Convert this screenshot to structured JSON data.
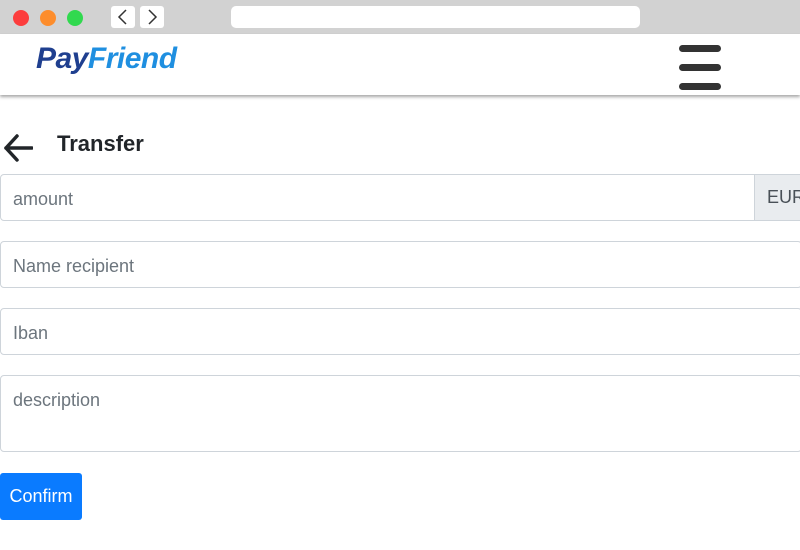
{
  "browser": {
    "back_icon": "chevron-left-icon",
    "forward_icon": "chevron-right-icon",
    "url": ""
  },
  "header": {
    "logo_part1": "Pay",
    "logo_part2": "Friend",
    "menu_icon": "hamburger-menu-icon"
  },
  "page": {
    "back_icon": "arrow-left-icon",
    "title": "Transfer"
  },
  "form": {
    "amount_placeholder": "amount",
    "currency": "EUR",
    "recipient_placeholder": "Name recipient",
    "iban_placeholder": "Iban",
    "description_placeholder": "description",
    "confirm_label": "Confirm"
  },
  "colors": {
    "primary_button": "#0a7bff",
    "logo_dark": "#1f3f8f",
    "logo_light": "#1f8fe0"
  }
}
